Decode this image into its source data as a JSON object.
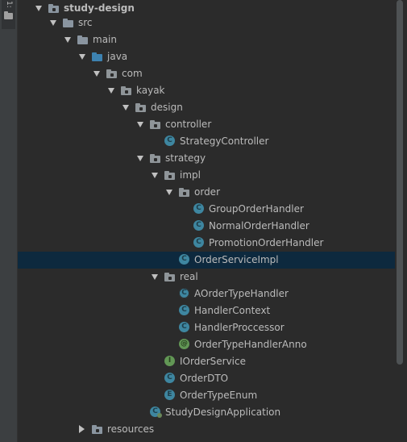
{
  "side_tab": {
    "number": "1:"
  },
  "colors": {
    "background": "#2b2b2b",
    "selection": "#0d293e",
    "folder_module": "#8a95a0",
    "folder_source": "#5f95b7",
    "folder_java": "#3d82b0",
    "folder_package": "#8f9599",
    "class_badge": "#3e86a0",
    "interface_badge": "#629755"
  },
  "tree": [
    {
      "label": "study-design",
      "expanded": true,
      "icon": "module-folder-icon",
      "root": true
    },
    {
      "label": "src",
      "expanded": true,
      "icon": "folder-icon"
    },
    {
      "label": "main",
      "expanded": true,
      "icon": "folder-icon"
    },
    {
      "label": "java",
      "expanded": true,
      "icon": "source-folder-icon"
    },
    {
      "label": "com",
      "expanded": true,
      "icon": "package-icon"
    },
    {
      "label": "kayak",
      "expanded": true,
      "icon": "package-icon"
    },
    {
      "label": "design",
      "expanded": true,
      "icon": "package-icon"
    },
    {
      "label": "controller",
      "expanded": true,
      "icon": "package-icon"
    },
    {
      "label": "StrategyController",
      "icon": "class-icon",
      "badge": "C"
    },
    {
      "label": "strategy",
      "expanded": true,
      "icon": "package-icon"
    },
    {
      "label": "impl",
      "expanded": true,
      "icon": "package-icon"
    },
    {
      "label": "order",
      "expanded": true,
      "icon": "package-icon"
    },
    {
      "label": "GroupOrderHandler",
      "icon": "class-icon",
      "badge": "C"
    },
    {
      "label": "NormalOrderHandler",
      "icon": "class-icon",
      "badge": "C"
    },
    {
      "label": "PromotionOrderHandler",
      "icon": "class-icon",
      "badge": "C"
    },
    {
      "label": "OrderServiceImpl",
      "icon": "class-icon",
      "badge": "C",
      "selected": true
    },
    {
      "label": "real",
      "expanded": true,
      "icon": "package-icon"
    },
    {
      "label": "AOrderTypeHandler",
      "icon": "abstract-class-icon",
      "badge": "C"
    },
    {
      "label": "HandlerContext",
      "icon": "class-icon",
      "badge": "C"
    },
    {
      "label": "HandlerProccessor",
      "icon": "class-icon",
      "badge": "C"
    },
    {
      "label": "OrderTypeHandlerAnno",
      "icon": "annotation-icon",
      "badge": "@"
    },
    {
      "label": "IOrderService",
      "icon": "interface-icon",
      "badge": "I"
    },
    {
      "label": "OrderDTO",
      "icon": "class-icon",
      "badge": "C"
    },
    {
      "label": "OrderTypeEnum",
      "icon": "enum-icon",
      "badge": "E"
    },
    {
      "label": "StudyDesignApplication",
      "icon": "spring-app-class-icon",
      "badge": "C"
    },
    {
      "label": "resources",
      "expanded": false,
      "icon": "resources-folder-icon"
    }
  ]
}
